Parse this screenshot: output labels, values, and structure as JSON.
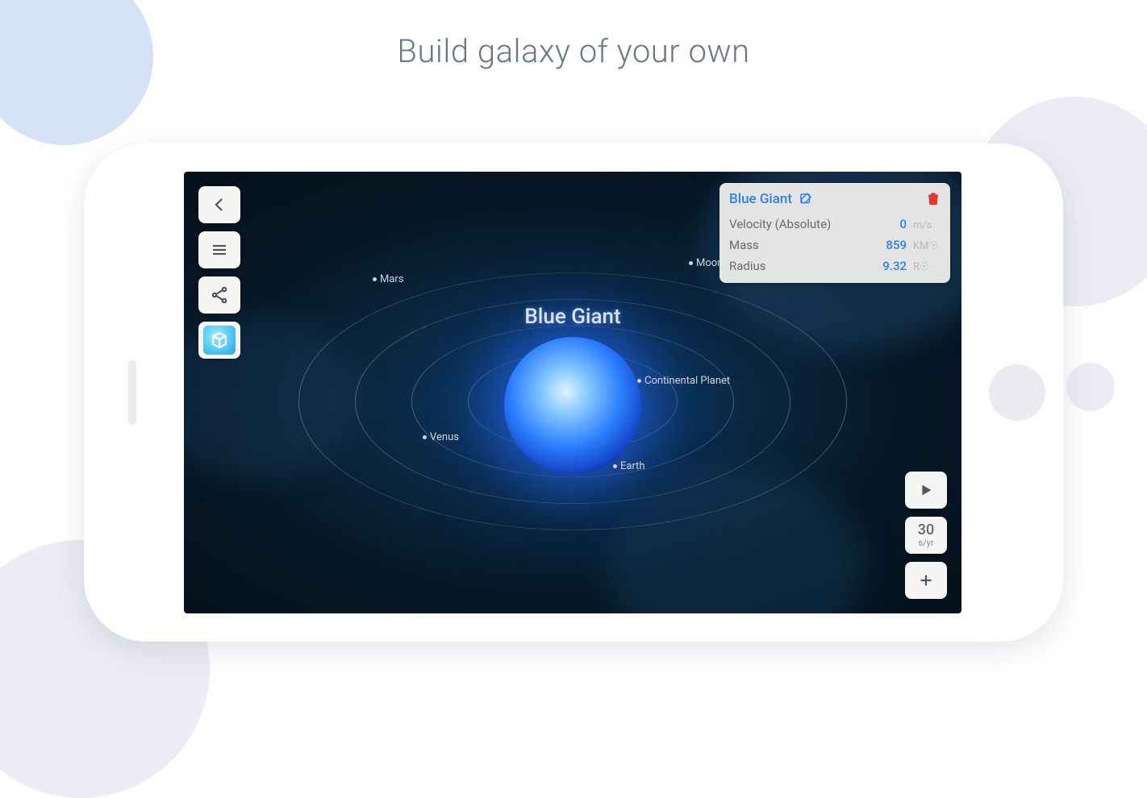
{
  "headline": "Build galaxy of your own",
  "star": {
    "name": "Blue Giant"
  },
  "planets": {
    "mars": "Mars",
    "moon": "Moon",
    "continental": "Continental Planet",
    "earth": "Earth",
    "venus": "Venus"
  },
  "panel": {
    "title": "Blue Giant",
    "rows": [
      {
        "label": "Velocity (Absolute)",
        "value": "0",
        "unit": "m/s"
      },
      {
        "label": "Mass",
        "value": "859",
        "unit": "KM☉"
      },
      {
        "label": "Radius",
        "value": "9.32",
        "unit": "R☉"
      }
    ]
  },
  "speed": {
    "value": "30",
    "unit": "s/yr"
  }
}
